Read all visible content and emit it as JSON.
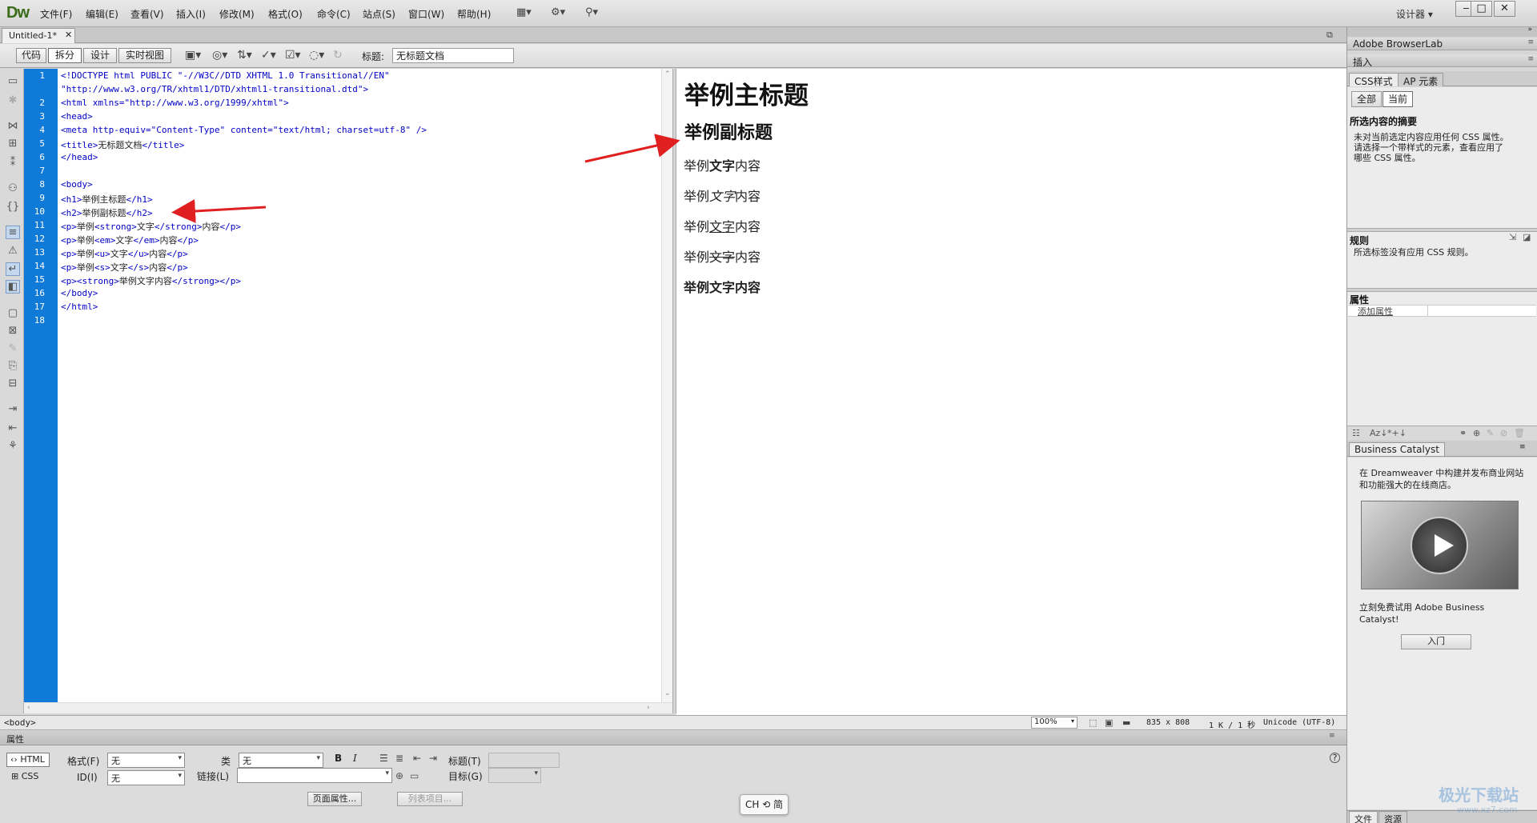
{
  "app": {
    "logo": "Dw",
    "menu": [
      "文件(F)",
      "编辑(E)",
      "查看(V)",
      "插入(I)",
      "修改(M)",
      "格式(O)",
      "命令(C)",
      "站点(S)",
      "窗口(W)",
      "帮助(H)"
    ],
    "workspace": "设计器",
    "window_buttons": [
      "‒",
      "□",
      "✕"
    ]
  },
  "doc": {
    "tab_name": "Untitled-1*",
    "view_buttons": [
      "代码",
      "拆分",
      "设计",
      "实时视图"
    ],
    "active_view": "拆分",
    "title_label": "标题:",
    "title_value": "无标题文档"
  },
  "code": {
    "line_numbers": [
      "1",
      "2",
      "3",
      "4",
      "5",
      "6",
      "7",
      "8",
      "9",
      "10",
      "11",
      "12",
      "13",
      "14",
      "15",
      "16",
      "17",
      "18"
    ],
    "lines": [
      "<!DOCTYPE html PUBLIC \"-//W3C//DTD XHTML 1.0 Transitional//EN\"",
      "\"http://www.w3.org/TR/xhtml1/DTD/xhtml1-transitional.dtd\">",
      "<html xmlns=\"http://www.w3.org/1999/xhtml\">",
      "<head>",
      "<meta http-equiv=\"Content-Type\" content=\"text/html; charset=utf-8\" />",
      "<title>",
      "无标题文档",
      "</title>",
      "</head>",
      "<body>",
      "<h1>",
      "举例主标题",
      "</h1>",
      "<h2>",
      "举例副标题",
      "</h2>",
      "<p>",
      "举例",
      "<strong>",
      "文字",
      "</strong>",
      "内容",
      "</p>",
      "<p>",
      "举例",
      "<em>",
      "文字",
      "</em>",
      "内容",
      "</p>",
      "<p>",
      "举例",
      "<u>",
      "文字",
      "</u>",
      "内容",
      "</p>",
      "<p>",
      "举例",
      "<s>",
      "文字",
      "</s>",
      "内容",
      "</p>",
      "<p><strong>",
      "举例文字内容",
      "</strong></p>",
      "</body>",
      "</html>"
    ]
  },
  "design": {
    "h1": "举例主标题",
    "h2": "举例副标题",
    "p1": [
      "举例",
      "文字",
      "内容"
    ],
    "p2": [
      "举例",
      "文字",
      "内容"
    ],
    "p3": [
      "举例",
      "文字",
      "内容"
    ],
    "p4": [
      "举例",
      "文字",
      "内容"
    ],
    "p5": "举例文字内容"
  },
  "status": {
    "tag": "<body>",
    "zoom": "100%",
    "dims": "835 x 808",
    "size": "1 K / 1 秒",
    "encoding": "Unicode (UTF-8)"
  },
  "properties": {
    "title": "属性",
    "html_btn": "HTML",
    "css_btn": "CSS",
    "format_label": "格式(F)",
    "format_value": "无",
    "class_label": "类",
    "class_value": "无",
    "id_label": "ID(I)",
    "id_value": "无",
    "link_label": "链接(L)",
    "link_value": "",
    "title_label": "标题(T)",
    "target_label": "目标(G)",
    "bold": "B",
    "italic": "I",
    "page_props": "页面属性...",
    "list_items": "列表项目..."
  },
  "ime": "CH ⟲ 简",
  "right": {
    "browserlab": "Adobe BrowserLab",
    "insert": "插入",
    "css_tab": "CSS样式",
    "ap_tab": "AP 元素",
    "all_btn": "全部",
    "current_btn": "当前",
    "summary_title": "所选内容的摘要",
    "summary_text": [
      "未对当前选定内容应用任何 CSS 属性。",
      "请选择一个带样式的元素，查看应用了",
      "哪些 CSS 属性。"
    ],
    "rules_title": "规则",
    "rules_text": "所选标签没有应用 CSS 规则。",
    "attr_title": "属性",
    "add_attr": "添加属性",
    "bc_title": "Business Catalyst",
    "bc_text": [
      "在 Dreamweaver 中构建并发布商业网站",
      "和功能强大的在线商店。"
    ],
    "bc_trial": [
      "立刻免费试用 Adobe Business",
      "Catalyst!"
    ],
    "bc_entry": "入门",
    "bottom_tabs": [
      "文件",
      "资源"
    ]
  },
  "watermark": {
    "name": "极光下载站",
    "url": "www.xz7.com"
  },
  "colors": {
    "gutter": "#0f7ad8",
    "code_tag": "#0000c8",
    "arrow": "#e02020"
  }
}
